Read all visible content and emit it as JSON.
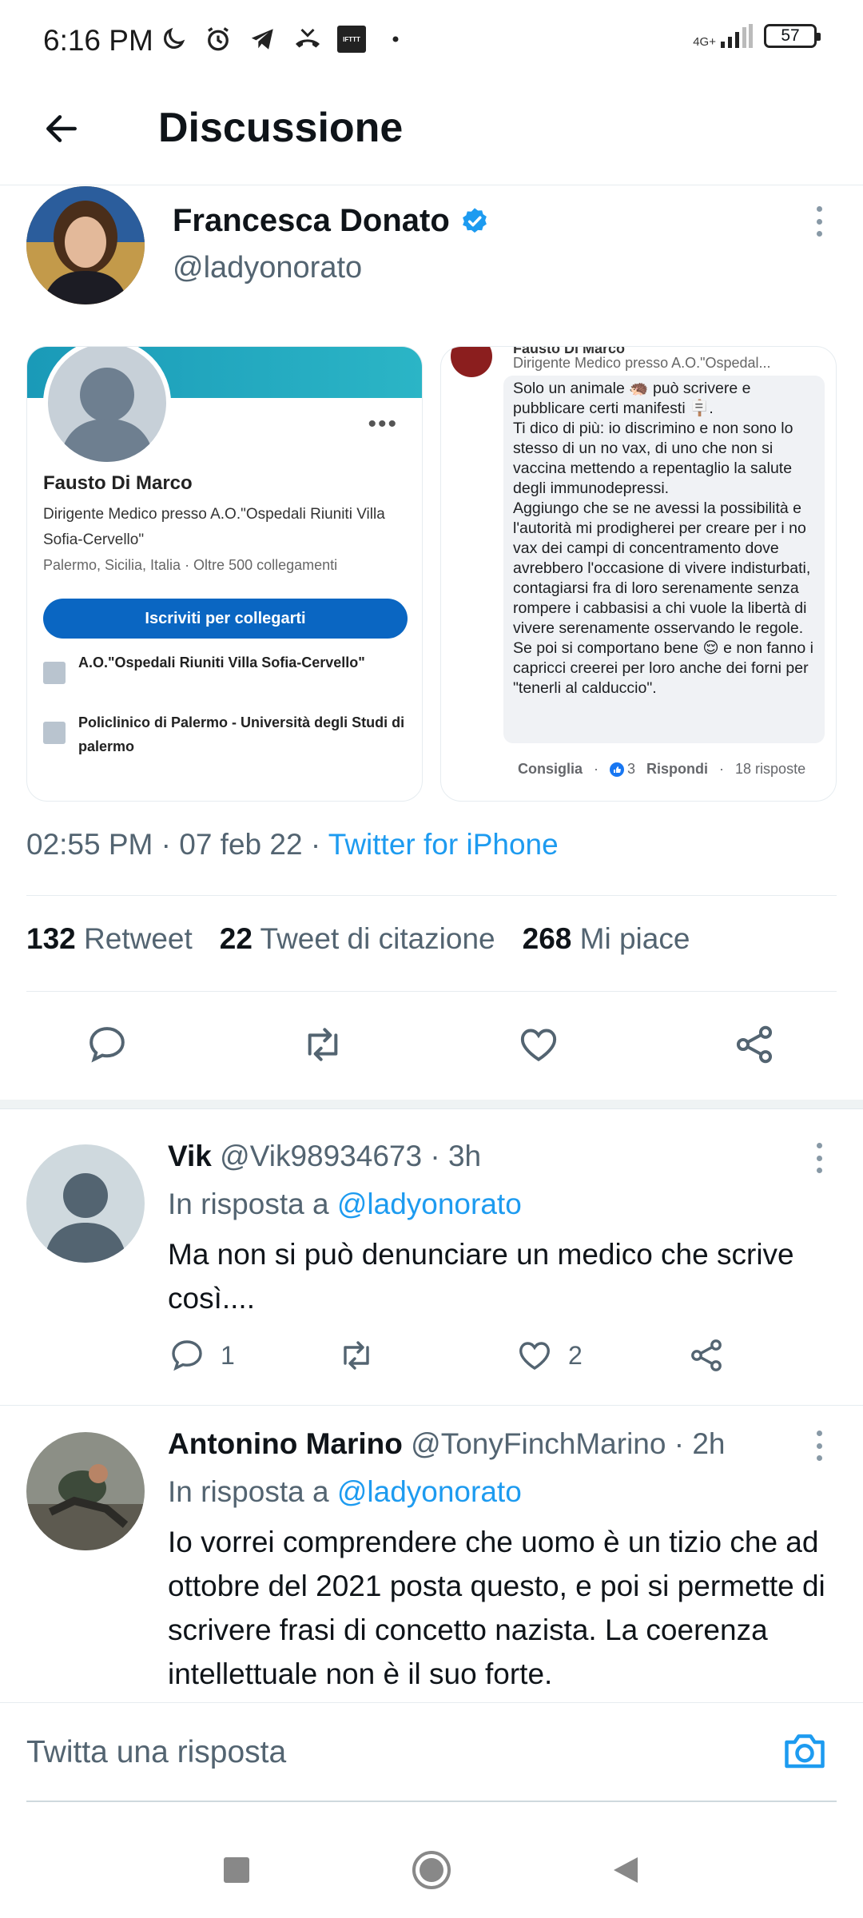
{
  "status_bar": {
    "time": "6:16 PM",
    "network": "4G+",
    "battery": "57",
    "icons": [
      "moon-icon",
      "alarm-icon",
      "telegram-icon",
      "missed-call-icon",
      "ifttt-icon",
      "dot-icon"
    ],
    "ifttt_label": "IFTTT"
  },
  "header": {
    "title": "Discussione"
  },
  "main_tweet": {
    "author_name": "Francesca Donato",
    "author_handle": "@ladyonorato",
    "verified": true,
    "timestamp": "02:55 PM · 07 feb 22 · ",
    "source": "Twitter for iPhone",
    "stats": {
      "retweets_count": "132",
      "retweets_label": "Retweet",
      "quotes_count": "22",
      "quotes_label": "Tweet di citazione",
      "likes_count": "268",
      "likes_label": "Mi piace"
    },
    "media": {
      "profile_card": {
        "name": "Fausto Di Marco",
        "job": "Dirigente Medico presso A.O.\"Ospedali Riuniti Villa Sofia-Cervello\"",
        "location": "Palermo, Sicilia, Italia  ·  Oltre 500 collegamenti",
        "cta": "Iscriviti per collegarti",
        "orgs": [
          "A.O.\"Ospedali Riuniti Villa Sofia-Cervello\"",
          "Policlinico di Palermo - Università degli Studi di palermo"
        ]
      },
      "comment_card": {
        "author": "Fausto Di Marco",
        "subtitle": "Dirigente Medico presso A.O.\"Ospedal...",
        "lines": [
          "Solo un animale 🦔 può scrivere e pubblicare certi manifesti 🪧.",
          "Ti dico di più: io discrimino e non sono lo stesso di un no vax, di uno che non si vaccina mettendo a repentaglio la salute degli immunodepressi.",
          "Aggiungo che se ne avessi la possibilità e l'autorità mi prodigherei per creare per i no vax dei campi di concentramento dove avrebbero l'occasione di vivere indisturbati, contagiarsi fra di loro serenamente senza rompere i cabbasisi a chi vuole la libertà di vivere serenamente osservando le regole.",
          "Se poi si comportano bene 😌 e non fanno i capricci creerei per loro anche dei forni per \"tenerli al calduccio\"."
        ],
        "footer_like": "Consiglia",
        "footer_reactions": "3",
        "footer_reply": "Rispondi",
        "footer_replies": "18 risposte"
      }
    }
  },
  "replies": [
    {
      "name": "Vik",
      "handle_time": " @Vik98934673 · 3h",
      "reply_to_label": "In risposta a ",
      "reply_to_handle": "@ladyonorato",
      "text": "Ma non si può denunciare un medico che scrive così....",
      "reply_count": "1",
      "retweet_count": "",
      "like_count": "2"
    },
    {
      "name": "Antonino Marino",
      "handle_time": " @TonyFinchMarino · 2h",
      "reply_to_label": "In risposta a ",
      "reply_to_handle": "@ladyonorato",
      "text": "Io vorrei comprendere che uomo è un tizio che ad ottobre del 2021 posta questo, e poi si permette di scrivere frasi di concetto nazista. La coerenza intellettuale non è il suo forte."
    }
  ],
  "composer": {
    "placeholder": "Twitta una risposta"
  },
  "colors": {
    "accent": "#1d9bf0",
    "text_primary": "#0f1419",
    "text_secondary": "#536471",
    "linkedin_blue": "#0a66c2"
  }
}
